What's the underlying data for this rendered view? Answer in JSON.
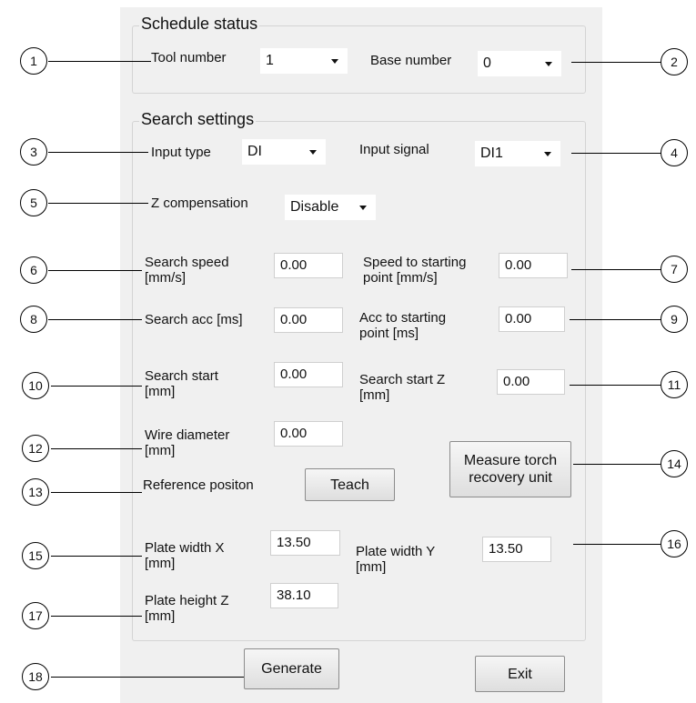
{
  "schedule_status": {
    "title": "Schedule status",
    "tool_number_label": "Tool number",
    "tool_number_value": "1",
    "base_number_label": "Base number",
    "base_number_value": "0"
  },
  "search_settings": {
    "title": "Search settings",
    "input_type_label": "Input type",
    "input_type_value": "DI",
    "input_signal_label": "Input signal",
    "input_signal_value": "DI1",
    "z_comp_label": "Z compensation",
    "z_comp_value": "Disable",
    "search_speed_label": "Search speed [mm/s]",
    "search_speed_value": "0.00",
    "speed_start_label": "Speed to starting point [mm/s]",
    "speed_start_value": "0.00",
    "search_acc_label": "Search acc [ms]",
    "search_acc_value": "0.00",
    "acc_start_label": "Acc to starting point [ms]",
    "acc_start_value": "0.00",
    "search_start_label": "Search start [mm]",
    "search_start_value": "0.00",
    "search_start_z_label": "Search start Z [mm]",
    "search_start_z_value": "0.00",
    "wire_diameter_label": "Wire diameter [mm]",
    "wire_diameter_value": "0.00",
    "reference_label": "Reference positon",
    "teach_label": "Teach",
    "measure_label": "Measure torch recovery unit",
    "plate_width_x_label": "Plate width X [mm]",
    "plate_width_x_value": "13.50",
    "plate_width_y_label": "Plate width Y [mm]",
    "plate_width_y_value": "13.50",
    "plate_height_z_label": "Plate height Z [mm]",
    "plate_height_z_value": "38.10"
  },
  "footer": {
    "generate_label": "Generate",
    "exit_label": "Exit"
  },
  "callouts": [
    "1",
    "2",
    "3",
    "4",
    "5",
    "6",
    "7",
    "8",
    "9",
    "10",
    "11",
    "12",
    "13",
    "14",
    "15",
    "16",
    "17",
    "18"
  ]
}
